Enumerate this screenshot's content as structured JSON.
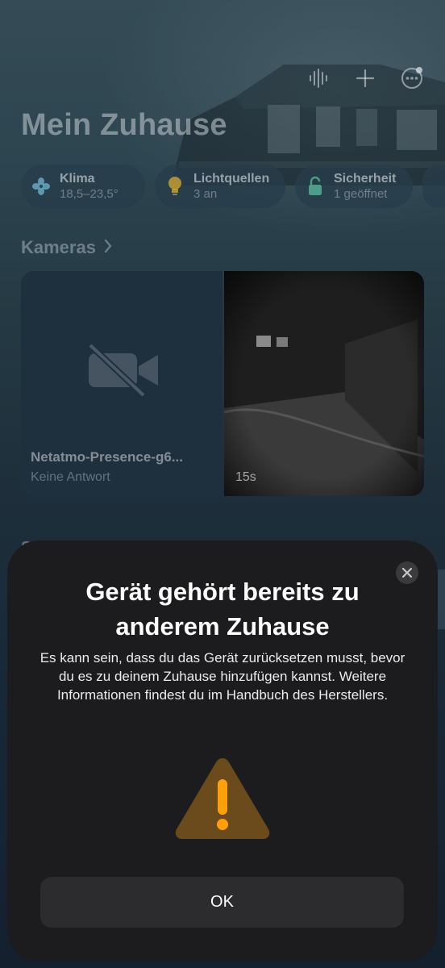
{
  "home": {
    "title": "Mein Zuhause",
    "chips": [
      {
        "label": "Klima",
        "sub": "18,5–23,5°",
        "icon": "fan-icon"
      },
      {
        "label": "Lichtquellen",
        "sub": "3 an",
        "icon": "lightbulb-icon"
      },
      {
        "label": "Sicherheit",
        "sub": "1 geöffnet",
        "icon": "lock-icon"
      }
    ],
    "cameras_header": "Kameras",
    "cameras": [
      {
        "name": "Netatmo-Presence-g6...",
        "status": "Keine Antwort"
      },
      {
        "time": "15s"
      }
    ],
    "next_section_peek": "S"
  },
  "toolbar": {
    "icons": [
      "waveform-icon",
      "plus-icon",
      "more-icon"
    ]
  },
  "dialog": {
    "title": "Gerät gehört bereits zu anderem Zuhause",
    "message": "Es kann sein, dass du das Gerät zurücksetzen musst, bevor du es zu deinem Zuhause hinzufügen kannst. Weitere Informationen findest du im Handbuch des Herstellers.",
    "ok_label": "OK",
    "warning_color": "#ff9f0a"
  }
}
